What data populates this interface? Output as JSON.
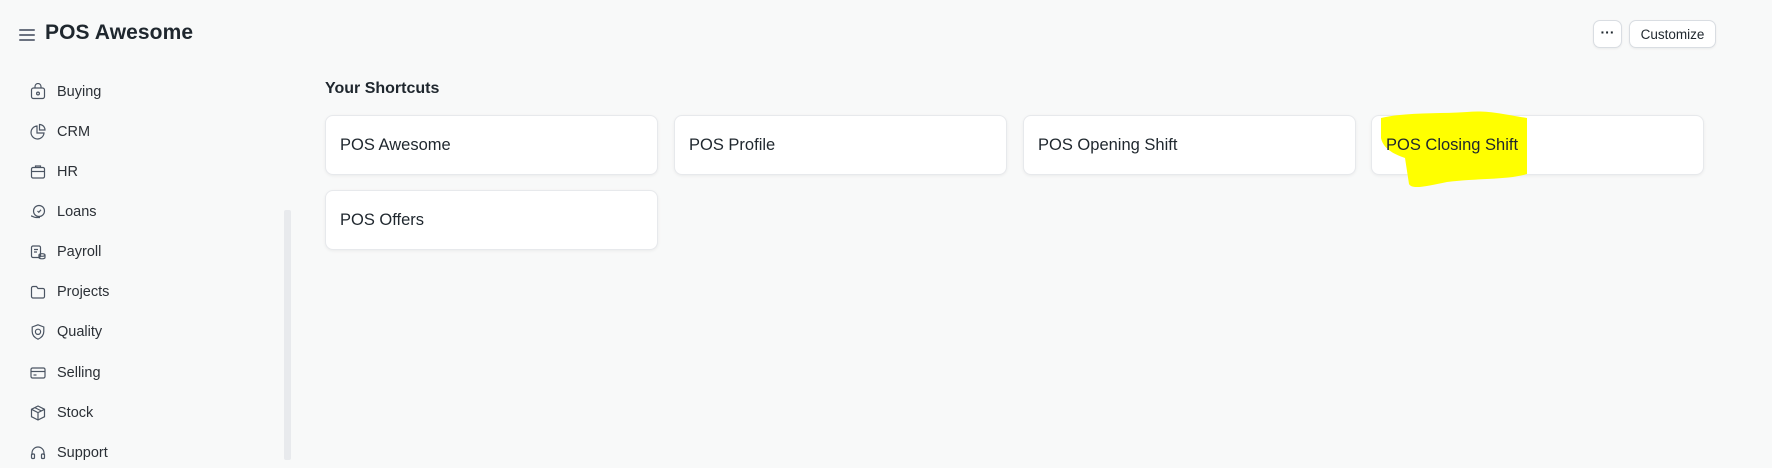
{
  "header": {
    "title": "POS Awesome",
    "menu_icon": "hamburger-menu-icon",
    "more_label": "···",
    "customize_label": "Customize"
  },
  "sidebar": {
    "items": [
      {
        "label": "Buying",
        "icon": "buying-icon"
      },
      {
        "label": "CRM",
        "icon": "crm-icon"
      },
      {
        "label": "HR",
        "icon": "hr-icon"
      },
      {
        "label": "Loans",
        "icon": "loans-icon"
      },
      {
        "label": "Payroll",
        "icon": "payroll-icon"
      },
      {
        "label": "Projects",
        "icon": "projects-icon"
      },
      {
        "label": "Quality",
        "icon": "quality-icon"
      },
      {
        "label": "Selling",
        "icon": "selling-icon"
      },
      {
        "label": "Stock",
        "icon": "stock-icon"
      },
      {
        "label": "Support",
        "icon": "support-icon"
      }
    ]
  },
  "shortcuts": {
    "title": "Your Shortcuts",
    "items": [
      {
        "label": "POS Awesome"
      },
      {
        "label": "POS Profile"
      },
      {
        "label": "POS Opening Shift"
      },
      {
        "label": "POS Closing Shift",
        "highlighted": true
      },
      {
        "label": "POS Offers"
      }
    ]
  },
  "colors": {
    "background": "#f8f9f9",
    "highlight": "#ffff00",
    "text": "#1f272e"
  }
}
